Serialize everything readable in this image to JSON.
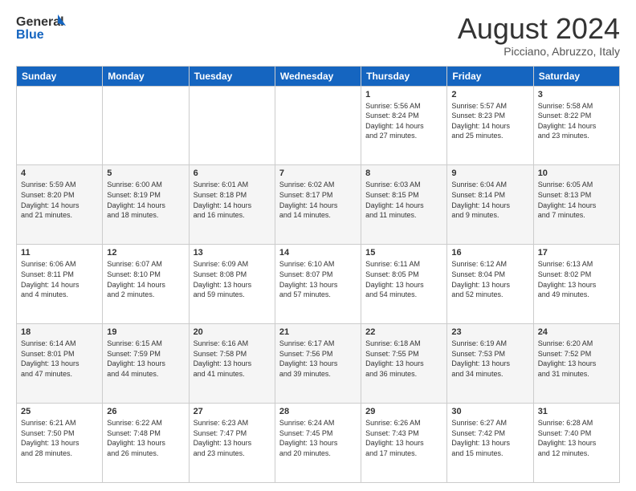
{
  "header": {
    "logo_line1": "General",
    "logo_line2": "Blue",
    "month_year": "August 2024",
    "location": "Picciano, Abruzzo, Italy"
  },
  "weekdays": [
    "Sunday",
    "Monday",
    "Tuesday",
    "Wednesday",
    "Thursday",
    "Friday",
    "Saturday"
  ],
  "rows": [
    [
      {
        "day": "",
        "info": ""
      },
      {
        "day": "",
        "info": ""
      },
      {
        "day": "",
        "info": ""
      },
      {
        "day": "",
        "info": ""
      },
      {
        "day": "1",
        "info": "Sunrise: 5:56 AM\nSunset: 8:24 PM\nDaylight: 14 hours\nand 27 minutes."
      },
      {
        "day": "2",
        "info": "Sunrise: 5:57 AM\nSunset: 8:23 PM\nDaylight: 14 hours\nand 25 minutes."
      },
      {
        "day": "3",
        "info": "Sunrise: 5:58 AM\nSunset: 8:22 PM\nDaylight: 14 hours\nand 23 minutes."
      }
    ],
    [
      {
        "day": "4",
        "info": "Sunrise: 5:59 AM\nSunset: 8:20 PM\nDaylight: 14 hours\nand 21 minutes."
      },
      {
        "day": "5",
        "info": "Sunrise: 6:00 AM\nSunset: 8:19 PM\nDaylight: 14 hours\nand 18 minutes."
      },
      {
        "day": "6",
        "info": "Sunrise: 6:01 AM\nSunset: 8:18 PM\nDaylight: 14 hours\nand 16 minutes."
      },
      {
        "day": "7",
        "info": "Sunrise: 6:02 AM\nSunset: 8:17 PM\nDaylight: 14 hours\nand 14 minutes."
      },
      {
        "day": "8",
        "info": "Sunrise: 6:03 AM\nSunset: 8:15 PM\nDaylight: 14 hours\nand 11 minutes."
      },
      {
        "day": "9",
        "info": "Sunrise: 6:04 AM\nSunset: 8:14 PM\nDaylight: 14 hours\nand 9 minutes."
      },
      {
        "day": "10",
        "info": "Sunrise: 6:05 AM\nSunset: 8:13 PM\nDaylight: 14 hours\nand 7 minutes."
      }
    ],
    [
      {
        "day": "11",
        "info": "Sunrise: 6:06 AM\nSunset: 8:11 PM\nDaylight: 14 hours\nand 4 minutes."
      },
      {
        "day": "12",
        "info": "Sunrise: 6:07 AM\nSunset: 8:10 PM\nDaylight: 14 hours\nand 2 minutes."
      },
      {
        "day": "13",
        "info": "Sunrise: 6:09 AM\nSunset: 8:08 PM\nDaylight: 13 hours\nand 59 minutes."
      },
      {
        "day": "14",
        "info": "Sunrise: 6:10 AM\nSunset: 8:07 PM\nDaylight: 13 hours\nand 57 minutes."
      },
      {
        "day": "15",
        "info": "Sunrise: 6:11 AM\nSunset: 8:05 PM\nDaylight: 13 hours\nand 54 minutes."
      },
      {
        "day": "16",
        "info": "Sunrise: 6:12 AM\nSunset: 8:04 PM\nDaylight: 13 hours\nand 52 minutes."
      },
      {
        "day": "17",
        "info": "Sunrise: 6:13 AM\nSunset: 8:02 PM\nDaylight: 13 hours\nand 49 minutes."
      }
    ],
    [
      {
        "day": "18",
        "info": "Sunrise: 6:14 AM\nSunset: 8:01 PM\nDaylight: 13 hours\nand 47 minutes."
      },
      {
        "day": "19",
        "info": "Sunrise: 6:15 AM\nSunset: 7:59 PM\nDaylight: 13 hours\nand 44 minutes."
      },
      {
        "day": "20",
        "info": "Sunrise: 6:16 AM\nSunset: 7:58 PM\nDaylight: 13 hours\nand 41 minutes."
      },
      {
        "day": "21",
        "info": "Sunrise: 6:17 AM\nSunset: 7:56 PM\nDaylight: 13 hours\nand 39 minutes."
      },
      {
        "day": "22",
        "info": "Sunrise: 6:18 AM\nSunset: 7:55 PM\nDaylight: 13 hours\nand 36 minutes."
      },
      {
        "day": "23",
        "info": "Sunrise: 6:19 AM\nSunset: 7:53 PM\nDaylight: 13 hours\nand 34 minutes."
      },
      {
        "day": "24",
        "info": "Sunrise: 6:20 AM\nSunset: 7:52 PM\nDaylight: 13 hours\nand 31 minutes."
      }
    ],
    [
      {
        "day": "25",
        "info": "Sunrise: 6:21 AM\nSunset: 7:50 PM\nDaylight: 13 hours\nand 28 minutes."
      },
      {
        "day": "26",
        "info": "Sunrise: 6:22 AM\nSunset: 7:48 PM\nDaylight: 13 hours\nand 26 minutes."
      },
      {
        "day": "27",
        "info": "Sunrise: 6:23 AM\nSunset: 7:47 PM\nDaylight: 13 hours\nand 23 minutes."
      },
      {
        "day": "28",
        "info": "Sunrise: 6:24 AM\nSunset: 7:45 PM\nDaylight: 13 hours\nand 20 minutes."
      },
      {
        "day": "29",
        "info": "Sunrise: 6:26 AM\nSunset: 7:43 PM\nDaylight: 13 hours\nand 17 minutes."
      },
      {
        "day": "30",
        "info": "Sunrise: 6:27 AM\nSunset: 7:42 PM\nDaylight: 13 hours\nand 15 minutes."
      },
      {
        "day": "31",
        "info": "Sunrise: 6:28 AM\nSunset: 7:40 PM\nDaylight: 13 hours\nand 12 minutes."
      }
    ]
  ]
}
